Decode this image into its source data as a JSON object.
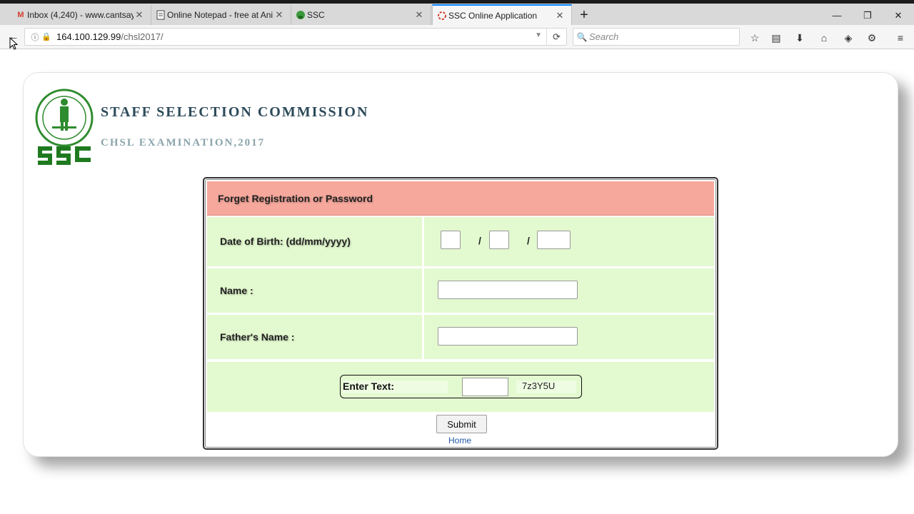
{
  "browser": {
    "tabs": [
      {
        "title": "Inbox (4,240) - www.cantsay",
        "icon": "gmail-icon"
      },
      {
        "title": "Online Notepad - free at Ani",
        "icon": "notepad-icon"
      },
      {
        "title": "SSC",
        "icon": "ssc-icon"
      },
      {
        "title": "SSC Online Application",
        "icon": "loading-icon",
        "active": true
      }
    ],
    "url_host": "164.100.129.99",
    "url_path": "/chsl2017/",
    "search_placeholder": "Search"
  },
  "header": {
    "org_name": "STAFF SELECTION COMMISSION",
    "exam_name": "CHSL EXAMINATION,2017"
  },
  "form": {
    "title": "Forget Registration or Password",
    "dob_label": "Date of Birth: (dd/mm/yyyy)",
    "dob_separator": "/",
    "name_label": "Name :",
    "father_label": "Father's Name :",
    "captcha_label": "Enter Text:",
    "captcha_code": "7z3Y5U",
    "submit_label": "Submit",
    "home_link": "Home"
  },
  "colors": {
    "header_bg": "#f6a89c",
    "row_bg": "#e3f9cf",
    "link": "#1f56a8",
    "accent_tab": "#0a84ff"
  }
}
